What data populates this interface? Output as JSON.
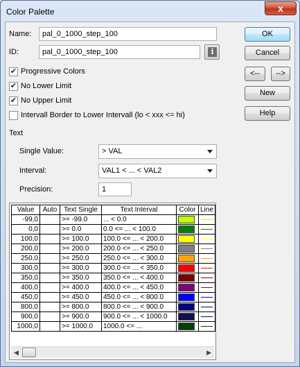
{
  "window": {
    "title": "Color Palette",
    "close_label": "x"
  },
  "fields": {
    "name_label": "Name:",
    "name_value": "pal_0_1000_step_100",
    "id_label": "ID:",
    "id_value": "pal_0_1000_step_100"
  },
  "buttons": {
    "ok": "OK",
    "cancel": "Cancel",
    "prev": "<--",
    "next": "-->",
    "new": "New",
    "help": "Help"
  },
  "checkboxes": [
    {
      "label": "Progressive Colors",
      "checked": true
    },
    {
      "label": "No Lower Limit",
      "checked": true
    },
    {
      "label": "No Upper Limit",
      "checked": true
    },
    {
      "label": "Intervall Border to Lower Intervall (lo < xxx <= hi)",
      "checked": false
    }
  ],
  "text_section": {
    "heading": "Text",
    "single_value_label": "Single Value:",
    "single_value_selected": "> VAL",
    "interval_label": "Interval:",
    "interval_selected": "VAL1 < ... < VAL2",
    "precision_label": "Precision:",
    "precision_value": "1"
  },
  "table": {
    "columns": [
      "Value",
      "Auto",
      "Text Single",
      "Text Interval",
      "Color",
      "Line"
    ],
    "rows": [
      {
        "value": "-99,0",
        "text_single": ">= -99.0",
        "text_interval": " ... < 0.0",
        "color": "#bfff00",
        "line": "#bfff00"
      },
      {
        "value": "0,0",
        "text_single": ">= 0.0",
        "text_interval": "0.0 <= ... < 100.0",
        "color": "#008000",
        "line": "#008000"
      },
      {
        "value": "100,0",
        "text_single": ">= 100.0",
        "text_interval": "100.0 <= ... < 200.0",
        "color": "#ffff00",
        "line": "#ffff00"
      },
      {
        "value": "200,0",
        "text_single": ">= 200.0",
        "text_interval": "200.0 <= ... < 250.0",
        "color": "#808080",
        "line": "#808080"
      },
      {
        "value": "250,0",
        "text_single": ">= 250.0",
        "text_interval": "250.0 <= ... < 300.0",
        "color": "#ffa500",
        "line": "#ffa500"
      },
      {
        "value": "300,0",
        "text_single": ">= 300.0",
        "text_interval": "300.0 <= ... < 350.0",
        "color": "#ff0000",
        "line": "#ff0000"
      },
      {
        "value": "350,0",
        "text_single": ">= 350.0",
        "text_interval": "350.0 <= ... < 400.0",
        "color": "#800000",
        "line": "#800000"
      },
      {
        "value": "400,0",
        "text_single": ">= 400.0",
        "text_interval": "400.0 <= ... < 450.0",
        "color": "#800080",
        "line": "#800080"
      },
      {
        "value": "450,0",
        "text_single": ">= 450.0",
        "text_interval": "450.0 <= ... < 800.0",
        "color": "#0000ff",
        "line": "#0000ff"
      },
      {
        "value": "800,0",
        "text_single": ">= 800.0",
        "text_interval": "800.0 <= ... < 900.0",
        "color": "#000080",
        "line": "#000080"
      },
      {
        "value": "900,0",
        "text_single": ">= 900.0",
        "text_interval": "900.0 <= ... < 1000.0",
        "color": "#101050",
        "line": "#101050"
      },
      {
        "value": "1000,0",
        "text_single": ">= 1000.0",
        "text_interval": "1000.0 <= ...",
        "color": "#004000",
        "line": "#004000"
      }
    ]
  }
}
